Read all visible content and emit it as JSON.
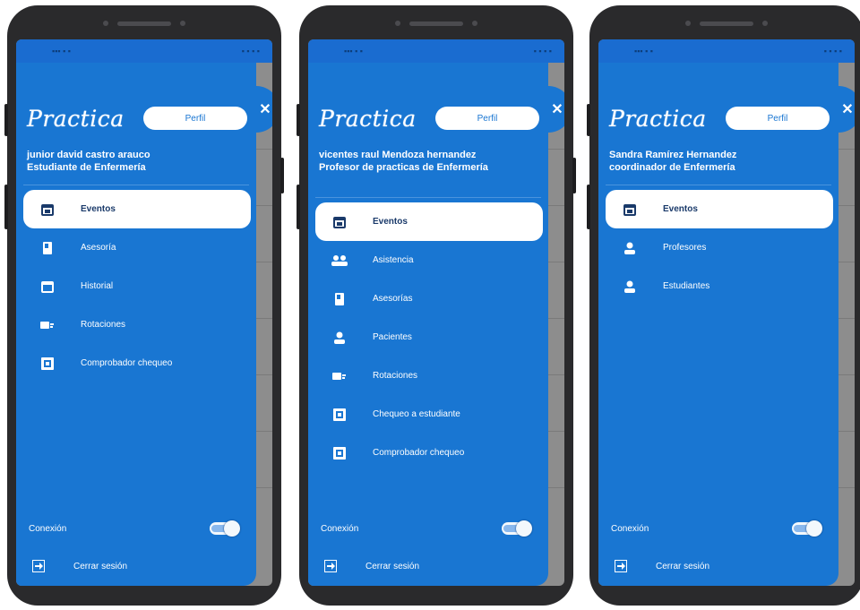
{
  "colors": {
    "drawer": "#1976d2",
    "active_item_bg": "#ffffff",
    "phone_body": "#2a2a2c"
  },
  "phones": [
    {
      "logo_text": "Practica",
      "perfil_label": "Perfil",
      "close_icon": "close-icon",
      "user_name": "junior david castro arauco",
      "user_role": "Estudiante de Enfermería",
      "menu": [
        {
          "label": "Eventos",
          "icon": "calendar-icon",
          "active": true
        },
        {
          "label": "Asesoría",
          "icon": "book-icon",
          "active": false
        },
        {
          "label": "Historial",
          "icon": "calendar-blank-icon",
          "active": false
        },
        {
          "label": "Rotaciones",
          "icon": "card-icon",
          "active": false
        },
        {
          "label": "Comprobador chequeo",
          "icon": "scan-icon",
          "active": false
        }
      ],
      "conexion_label": "Conexión",
      "conexion_on": true,
      "logout_label": "Cerrar sesión"
    },
    {
      "logo_text": "Practica",
      "perfil_label": "Perfil",
      "close_icon": "close-icon",
      "user_name": "vicentes raul Mendoza hernandez",
      "user_role": "Profesor de practicas de Enfermería",
      "menu": [
        {
          "label": "Eventos",
          "icon": "calendar-icon",
          "active": true
        },
        {
          "label": "Asistencia",
          "icon": "group-icon",
          "active": false
        },
        {
          "label": "Asesorías",
          "icon": "book-icon",
          "active": false
        },
        {
          "label": "Pacientes",
          "icon": "person-icon",
          "active": false
        },
        {
          "label": "Rotaciones",
          "icon": "card-icon",
          "active": false
        },
        {
          "label": "Chequeo a estudiante",
          "icon": "scan-icon",
          "active": false
        },
        {
          "label": "Comprobador chequeo",
          "icon": "scan-icon",
          "active": false
        }
      ],
      "conexion_label": "Conexión",
      "conexion_on": true,
      "logout_label": "Cerrar sesión"
    },
    {
      "logo_text": "Practica",
      "perfil_label": "Perfil",
      "close_icon": "close-icon",
      "user_name": "Sandra Ramírez Hernandez",
      "user_role": "coordinador de Enfermería",
      "menu": [
        {
          "label": "Eventos",
          "icon": "calendar-icon",
          "active": true
        },
        {
          "label": "Profesores",
          "icon": "person-icon",
          "active": false
        },
        {
          "label": "Estudiantes",
          "icon": "person-icon",
          "active": false
        }
      ],
      "conexion_label": "Conexión",
      "conexion_on": true,
      "logout_label": "Cerrar sesión"
    }
  ]
}
